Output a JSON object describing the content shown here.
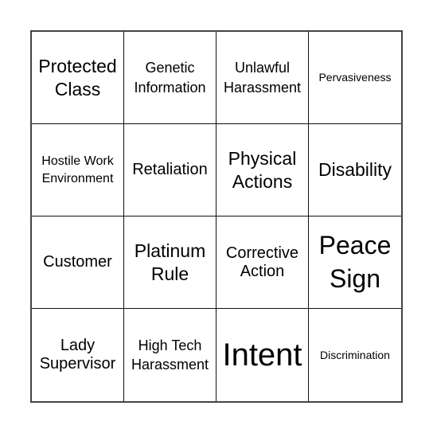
{
  "board": {
    "rows": 4,
    "cols": 4,
    "cells": [
      {
        "text": "Protected Class",
        "size": "xl"
      },
      {
        "text": "Genetic Information",
        "size": "m"
      },
      {
        "text": "Unlawful Harassment",
        "size": "m"
      },
      {
        "text": "Pervasiveness",
        "size": "xs"
      },
      {
        "text": "Hostile Work Environment",
        "size": "s"
      },
      {
        "text": "Retaliation",
        "size": "l"
      },
      {
        "text": "Physical Actions",
        "size": "xl"
      },
      {
        "text": "Disability",
        "size": "xl"
      },
      {
        "text": "Customer",
        "size": "l"
      },
      {
        "text": "Platinum Rule",
        "size": "xl"
      },
      {
        "text": "Corrective Action",
        "size": "l"
      },
      {
        "text": "Peace Sign",
        "size": "xxl"
      },
      {
        "text": "Lady Supervisor",
        "size": "l"
      },
      {
        "text": "High Tech Harassment",
        "size": "m"
      },
      {
        "text": "Intent",
        "size": "huge"
      },
      {
        "text": "Discrimination",
        "size": "xs"
      }
    ]
  }
}
